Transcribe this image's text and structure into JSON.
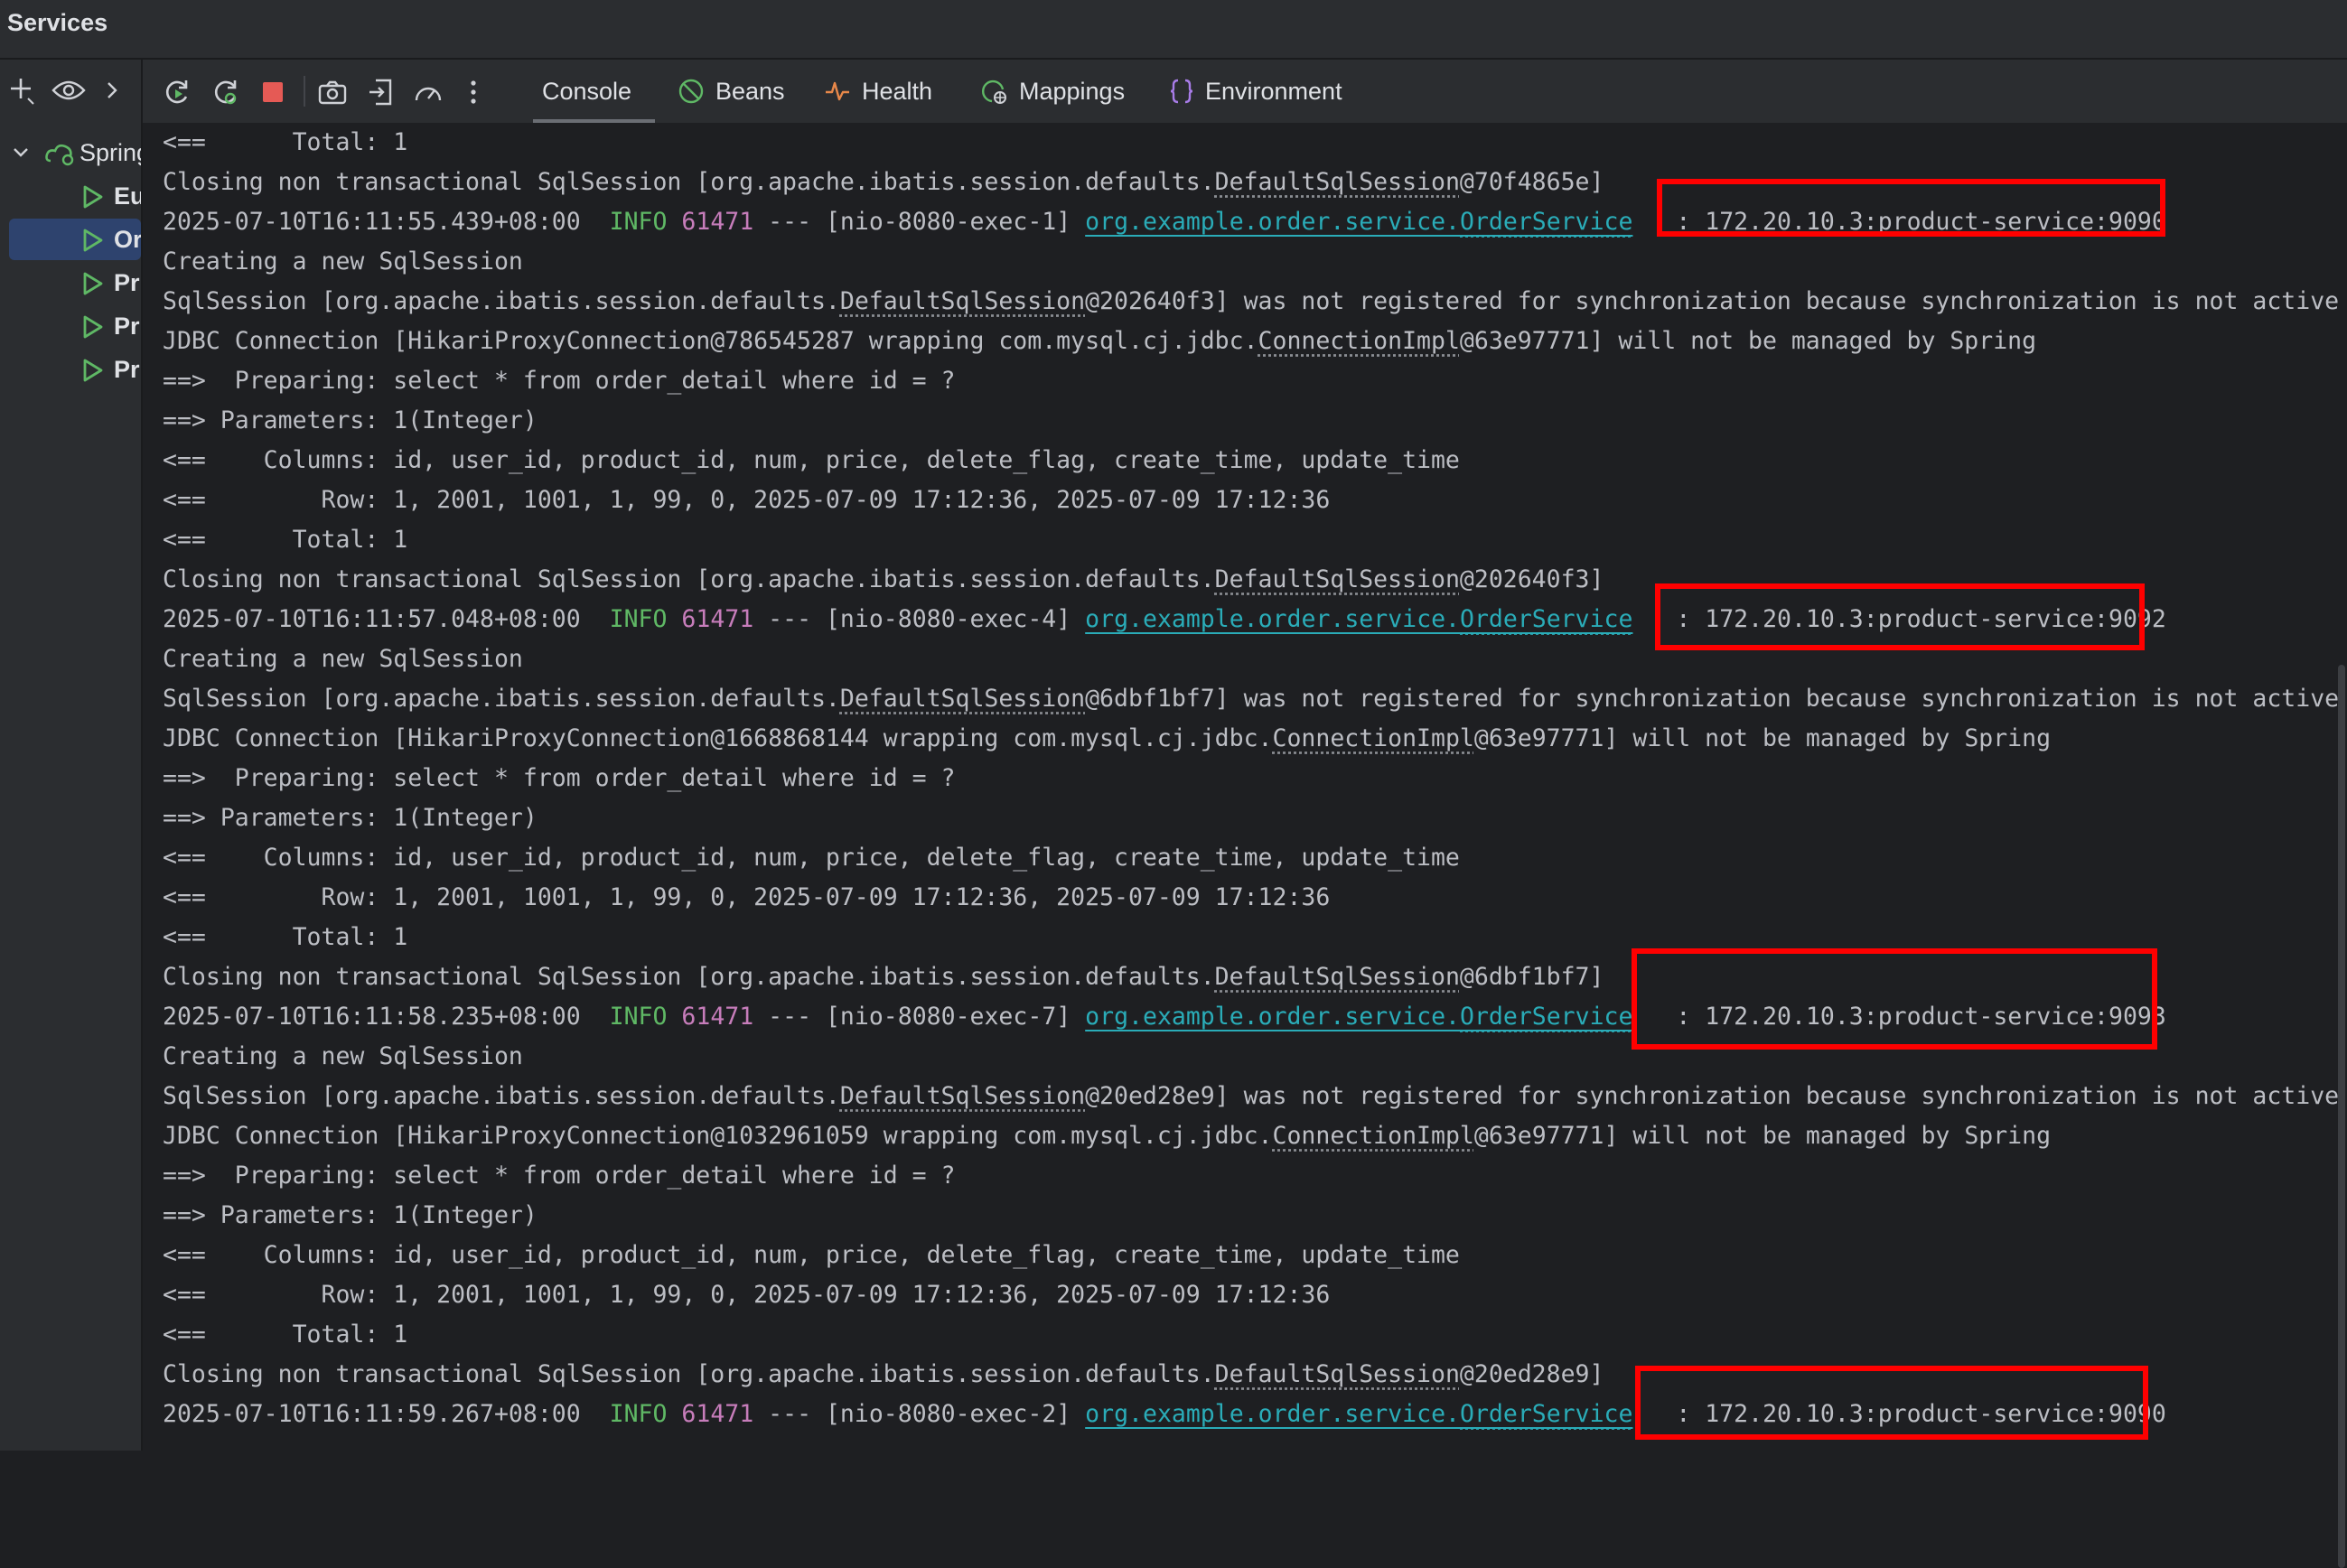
{
  "window": {
    "title": "Services"
  },
  "tabs": [
    {
      "label": "Console",
      "icon": "console",
      "active": true
    },
    {
      "label": "Beans",
      "icon": "beans-icon"
    },
    {
      "label": "Health",
      "icon": "health-icon"
    },
    {
      "label": "Mappings",
      "icon": "mappings-icon"
    },
    {
      "label": "Environment",
      "icon": "environment-icon"
    }
  ],
  "sidebar": {
    "root": "Spring",
    "items": [
      {
        "label": "Eu",
        "selected": false
      },
      {
        "label": "Or",
        "selected": true
      },
      {
        "label": "Pr",
        "selected": false
      },
      {
        "label": "Pr",
        "selected": false
      },
      {
        "label": "Pr",
        "selected": false
      }
    ]
  },
  "console": {
    "lines": [
      {
        "type": "plain",
        "text": "<==      Total: 1"
      },
      {
        "type": "closing",
        "pre": "Closing non transactional SqlSession [org.apache.ibatis.session.defaults.",
        "cls": "DefaultSqlSession",
        "post": "@70f4865e]"
      },
      {
        "type": "info",
        "ts": "2025-07-10T16:11:55.439+08:00",
        "level": "INFO",
        "pid": "61471",
        "thread": "--- [nio-8080-exec-1]",
        "logger_pkg": "org.example.order.service.",
        "logger_cls": "OrderService",
        "sep": ":",
        "msg": "172.20.10.3:product-service:9090"
      },
      {
        "type": "plain",
        "text": "Creating a new SqlSession"
      },
      {
        "type": "sqlsession",
        "pre": "SqlSession [org.apache.ibatis.session.defaults.",
        "cls": "DefaultSqlSession",
        "post": "@202640f3] was not registered for synchronization because synchronization is not active"
      },
      {
        "type": "jdbc",
        "pre": "JDBC Connection [HikariProxyConnection@786545287 wrapping com.mysql.cj.jdbc.",
        "cls": "ConnectionImpl",
        "post": "@63e97771] will not be managed by Spring"
      },
      {
        "type": "plain",
        "text": "==>  Preparing: select * from order_detail where id = ?"
      },
      {
        "type": "plain",
        "text": "==> Parameters: 1(Integer)"
      },
      {
        "type": "plain",
        "text": "<==    Columns: id, user_id, product_id, num, price, delete_flag, create_time, update_time"
      },
      {
        "type": "plain",
        "text": "<==        Row: 1, 2001, 1001, 1, 99, 0, 2025-07-09 17:12:36, 2025-07-09 17:12:36"
      },
      {
        "type": "plain",
        "text": "<==      Total: 1"
      },
      {
        "type": "closing",
        "pre": "Closing non transactional SqlSession [org.apache.ibatis.session.defaults.",
        "cls": "DefaultSqlSession",
        "post": "@202640f3]"
      },
      {
        "type": "info",
        "ts": "2025-07-10T16:11:57.048+08:00",
        "level": "INFO",
        "pid": "61471",
        "thread": "--- [nio-8080-exec-4]",
        "logger_pkg": "org.example.order.service.",
        "logger_cls": "OrderService",
        "sep": ":",
        "msg": "172.20.10.3:product-service:9092"
      },
      {
        "type": "plain",
        "text": "Creating a new SqlSession"
      },
      {
        "type": "sqlsession",
        "pre": "SqlSession [org.apache.ibatis.session.defaults.",
        "cls": "DefaultSqlSession",
        "post": "@6dbf1bf7] was not registered for synchronization because synchronization is not active"
      },
      {
        "type": "jdbc",
        "pre": "JDBC Connection [HikariProxyConnection@1668868144 wrapping com.mysql.cj.jdbc.",
        "cls": "ConnectionImpl",
        "post": "@63e97771] will not be managed by Spring"
      },
      {
        "type": "plain",
        "text": "==>  Preparing: select * from order_detail where id = ?"
      },
      {
        "type": "plain",
        "text": "==> Parameters: 1(Integer)"
      },
      {
        "type": "plain",
        "text": "<==    Columns: id, user_id, product_id, num, price, delete_flag, create_time, update_time"
      },
      {
        "type": "plain",
        "text": "<==        Row: 1, 2001, 1001, 1, 99, 0, 2025-07-09 17:12:36, 2025-07-09 17:12:36"
      },
      {
        "type": "plain",
        "text": "<==      Total: 1"
      },
      {
        "type": "closing",
        "pre": "Closing non transactional SqlSession [org.apache.ibatis.session.defaults.",
        "cls": "DefaultSqlSession",
        "post": "@6dbf1bf7]"
      },
      {
        "type": "info",
        "ts": "2025-07-10T16:11:58.235+08:00",
        "level": "INFO",
        "pid": "61471",
        "thread": "--- [nio-8080-exec-7]",
        "logger_pkg": "org.example.order.service.",
        "logger_cls": "OrderService",
        "sep": ":",
        "msg": "172.20.10.3:product-service:9093"
      },
      {
        "type": "plain",
        "text": "Creating a new SqlSession"
      },
      {
        "type": "sqlsession",
        "pre": "SqlSession [org.apache.ibatis.session.defaults.",
        "cls": "DefaultSqlSession",
        "post": "@20ed28e9] was not registered for synchronization because synchronization is not active"
      },
      {
        "type": "jdbc",
        "pre": "JDBC Connection [HikariProxyConnection@1032961059 wrapping com.mysql.cj.jdbc.",
        "cls": "ConnectionImpl",
        "post": "@63e97771] will not be managed by Spring"
      },
      {
        "type": "plain",
        "text": "==>  Preparing: select * from order_detail where id = ?"
      },
      {
        "type": "plain",
        "text": "==> Parameters: 1(Integer)"
      },
      {
        "type": "plain",
        "text": "<==    Columns: id, user_id, product_id, num, price, delete_flag, create_time, update_time"
      },
      {
        "type": "plain",
        "text": "<==        Row: 1, 2001, 1001, 1, 99, 0, 2025-07-09 17:12:36, 2025-07-09 17:12:36"
      },
      {
        "type": "plain",
        "text": "<==      Total: 1"
      },
      {
        "type": "closing",
        "pre": "Closing non transactional SqlSession [org.apache.ibatis.session.defaults.",
        "cls": "DefaultSqlSession",
        "post": "@20ed28e9]"
      },
      {
        "type": "info",
        "ts": "2025-07-10T16:11:59.267+08:00",
        "level": "INFO",
        "pid": "61471",
        "thread": "--- [nio-8080-exec-2]",
        "logger_pkg": "org.example.order.service.",
        "logger_cls": "OrderService",
        "sep": ":",
        "msg": "172.20.10.3:product-service:9090"
      }
    ]
  },
  "colors": {
    "background": "#1e1f22",
    "panel": "#2b2d30",
    "info": "#5fb865",
    "pid": "#c77dbb",
    "logger": "#2aacb8",
    "highlight_box": "#ff0000",
    "selected_row": "#2e436e"
  }
}
